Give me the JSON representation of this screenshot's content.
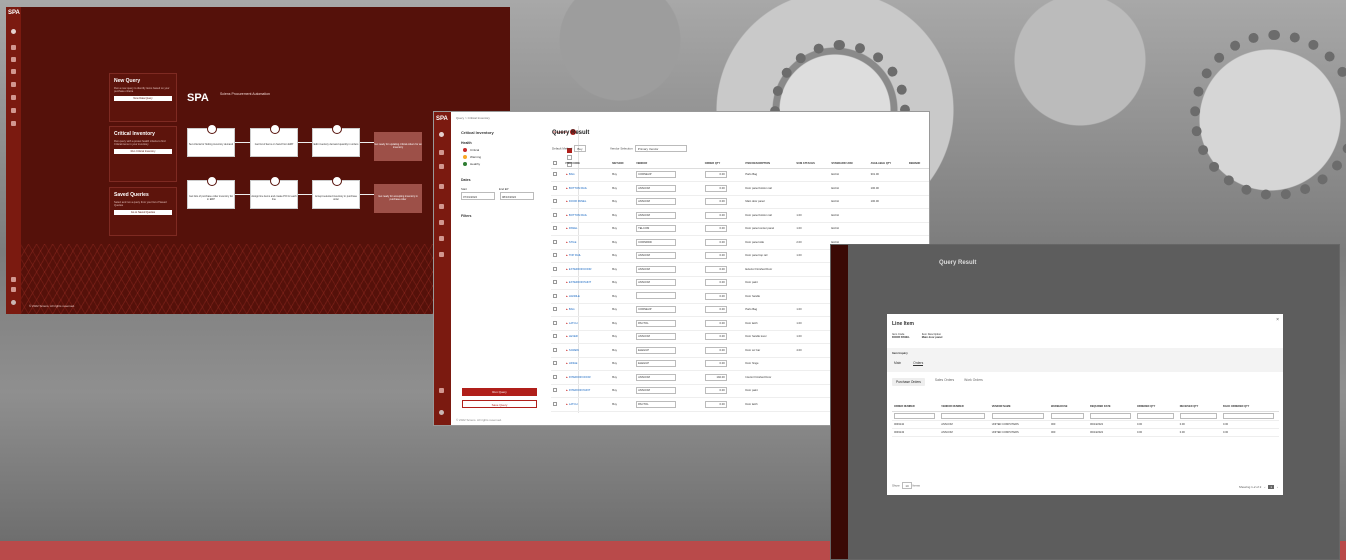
{
  "screen1": {
    "logo": "SPA",
    "brand": {
      "name": "SPA",
      "subtitle": "Sciens Procurement Automation"
    },
    "cards": [
      {
        "title": "New Query",
        "desc": "Run a new query to identify items based on your purchase criteria",
        "button": "New Data Query"
      },
      {
        "title": "Critical Inventory",
        "desc": "Run query with a preset health criteria to find Critical items in your inventory",
        "button": "Run Critical Inventory"
      },
      {
        "title": "Saved Queries",
        "desc": "Select and run a query from your list of Saved Queries",
        "button": "Go to Saved Queries"
      }
    ],
    "steps": [
      "Set criteria for finding inventory demand",
      "Get list of items on hand from ERP",
      "Edit inventory demand quantity in orders",
      "Get lists of purchase order inventory list in ERP",
      "Assign line items and create PO for each line",
      "Accept selected inventory in purchase order"
    ],
    "final_steps": [
      "Get ready for updating critical orders for an inventory",
      "Get ready for accepting inventory in purchase order"
    ],
    "footer": "© 2022 Sciens. All rights reserved."
  },
  "screen2": {
    "logo": "SPA",
    "breadcrumb": "Query > Critical Inventory",
    "panel_title": "Critical Inventory",
    "reset_label": "Reset Data",
    "health_label": "Health",
    "health": [
      {
        "label": "Critical",
        "color": "#c62828",
        "checked": true
      },
      {
        "label": "Warning",
        "color": "#f9a825",
        "checked": false
      },
      {
        "label": "Healthy",
        "color": "#2e7d32",
        "checked": false
      }
    ],
    "dates_label": "Dates",
    "start_label": "Start",
    "end_label": "End EP",
    "start": "07/01/2022",
    "end": "08/16/2022",
    "filters_label": "Filters",
    "run_btn": "Run Query",
    "save_btn": "Save Query",
    "title": "Query Result",
    "default_sel_label": "Default Method",
    "default_sel": "Buy",
    "vendor_sel_label": "Vendor Selection",
    "vendor_sel": "Primary Vendor",
    "headers": [
      "ITEM CODE",
      "METHOD",
      "VENDOR",
      "ORDER QTY",
      "ITEM DESCRIPTION",
      "SUM ATTACHS",
      "STANDARD UOM",
      "AVAILABLE QTY",
      "DEMAND"
    ],
    "rows": [
      [
        "BAG",
        "Buy",
        "CORNEUP",
        "0.00",
        "Parts Bag",
        "",
        "EACH",
        "301.00"
      ],
      [
        "BOTTOM RAIL",
        "Buy",
        "ANSCOM",
        "0.00",
        "Door panel bottom rail",
        "",
        "EACH",
        "100.00"
      ],
      [
        "DOOR PANEL",
        "Buy",
        "ANSCOM",
        "0.00",
        "Main door panel",
        "",
        "EACH",
        "100.00"
      ],
      [
        "BOTTOM RAIL",
        "Buy",
        "ANSCOM",
        "0.00",
        "Door panel bottom rail",
        "1.00",
        "EACH",
        ""
      ],
      [
        "PANEL",
        "Buy",
        "TELCOM",
        "0.00",
        "Door panel center panel",
        "1.00",
        "EACH",
        ""
      ],
      [
        "STILE",
        "Buy",
        "CORNRDD",
        "0.00",
        "Door panel stile",
        "2.00",
        "EACH",
        ""
      ],
      [
        "TOP RAIL",
        "Buy",
        "ANSCOM",
        "0.00",
        "Door panel top rail",
        "1.00",
        "EACH",
        ""
      ],
      [
        "EXTERIOR DOOR",
        "Buy",
        "ANSCOM",
        "0.00",
        "Exterior Finished Door",
        "",
        "",
        ""
      ],
      [
        "EXTERIOR PAINT",
        "Buy",
        "ANSCOM",
        "0.00",
        "Door paint",
        "",
        "",
        ""
      ],
      [
        "HANDLE",
        "Buy",
        "",
        "0.00",
        "Door handle",
        "",
        "",
        ""
      ],
      [
        "BAG",
        "Buy",
        "CORNEUP",
        "0.00",
        "Parts Bag",
        "1.00",
        "",
        ""
      ],
      [
        "LATCH",
        "Buy",
        "PACTOL",
        "0.00",
        "Door latch",
        "1.00",
        "",
        ""
      ],
      [
        "LEVER",
        "Buy",
        "ANSCOM",
        "0.00",
        "Door handle lever",
        "1.00",
        "",
        ""
      ],
      [
        "SCREW",
        "Buy",
        "ELEGUP",
        "0.00",
        "Door scr bar",
        "4.00",
        "",
        ""
      ],
      [
        "HINGE",
        "Buy",
        "ELEGUP",
        "0.00",
        "Door hinge",
        "",
        "",
        ""
      ],
      [
        "INTERIOR DOOR",
        "Buy",
        "ANSCOM",
        "192.00",
        "Interior Finished Door",
        "",
        "",
        ""
      ],
      [
        "INTERIOR PAINT",
        "Buy",
        "ANSCOM",
        "0.00",
        "Door paint",
        "",
        "",
        ""
      ],
      [
        "LATCH",
        "Buy",
        "PACTOL",
        "0.00",
        "Door latch",
        "",
        "",
        ""
      ]
    ],
    "footer": "© 2022 Sciens. All rights reserved."
  },
  "screen3": {
    "under_title": "Query Result",
    "modal_title": "Line Item",
    "item_code_label": "Item Code",
    "item_code": "DOOR PANEL",
    "item_desc_label": "Item Description",
    "item_desc": "Main door panel",
    "band_label": "Item Inquiry",
    "tabs": [
      "Main",
      "Orders"
    ],
    "subtabs": [
      "Purchase Orders",
      "Sales Orders",
      "Work Orders"
    ],
    "headers": [
      "ORDER NUMBER",
      "VENDOR NUMBER",
      "VENDOR NAME",
      "WAREHOUSE",
      "REQUIRED DATE",
      "ORDERED QTY",
      "RECEIVED QTY",
      "BACK ORDERED QTY"
    ],
    "rows": [
      [
        "0093142",
        "ANSCOM",
        "UNITED COMPUTERS",
        "000",
        "06/24/2022",
        "0.00",
        "0.00",
        "0.00"
      ],
      [
        "0093143",
        "ANSCOM",
        "UNITED COMPUTERS",
        "000",
        "06/24/2022",
        "0.00",
        "0.00",
        "0.00"
      ]
    ],
    "show_label": "Show",
    "show_val": "10",
    "rows_label": "Items",
    "showing": "Showing 1-2 of 2",
    "page": "1"
  }
}
